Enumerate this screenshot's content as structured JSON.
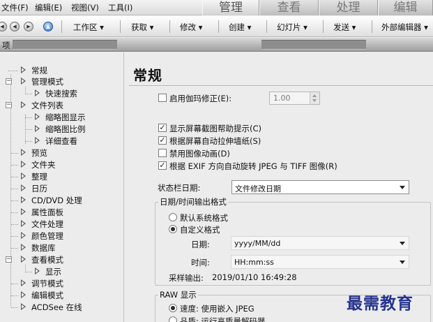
{
  "menubar": {
    "items": [
      "文件(F)",
      "编辑(E)",
      "视图(V)",
      "工具(I)"
    ],
    "mode_tabs": [
      "管理",
      "查看",
      "处理",
      "编辑"
    ]
  },
  "toolbar": {
    "items": [
      "工作区 ▾",
      "获取 ▾",
      "修改 ▾",
      "创建 ▾",
      "幻灯片 ▾",
      "发送 ▾",
      "外部编辑器 ▾"
    ]
  },
  "pane": {
    "title": "项"
  },
  "tree": {
    "items": [
      "常规",
      "管理模式",
      "快速搜索",
      "文件列表",
      "缩略图显示",
      "缩略图比例",
      "详细查看",
      "预览",
      "文件夹",
      "整理",
      "日历",
      "CD/DVD 处理",
      "属性面板",
      "文件处理",
      "颜色管理",
      "数据库",
      "查看模式",
      "显示",
      "调节模式",
      "编辑模式",
      "ACDSee 在线"
    ]
  },
  "content": {
    "title": "常规",
    "gamma": {
      "label": "启用伽玛修正(E):",
      "value": "1.00"
    },
    "options": [
      "显示屏幕截图帮助提示(C)",
      "根据屏幕自动拉伸墙纸(S)",
      "禁用图像动画(D)",
      "根据 EXIF 方向自动旋转 JPEG 与 TIFF 图像(R)"
    ],
    "status_date": {
      "label": "状态栏日期:",
      "value": "文件修改日期"
    },
    "datetime_group": {
      "legend": "日期/时间输出格式",
      "radio_default": "默认系统格式",
      "radio_custom": "自定义格式",
      "date_label": "日期:",
      "date_value": "yyyy/MM/dd",
      "time_label": "时间:",
      "time_value": "HH:mm:ss",
      "sample_label": "采样输出:",
      "sample_value": "2019/01/10 16:49:28"
    },
    "raw_group": {
      "legend": "RAW 显示",
      "radio_speed": "速度: 使用嵌入 JPEG",
      "radio_quality": "品质: 运行高质量解码器"
    }
  },
  "watermark": "最需教育"
}
